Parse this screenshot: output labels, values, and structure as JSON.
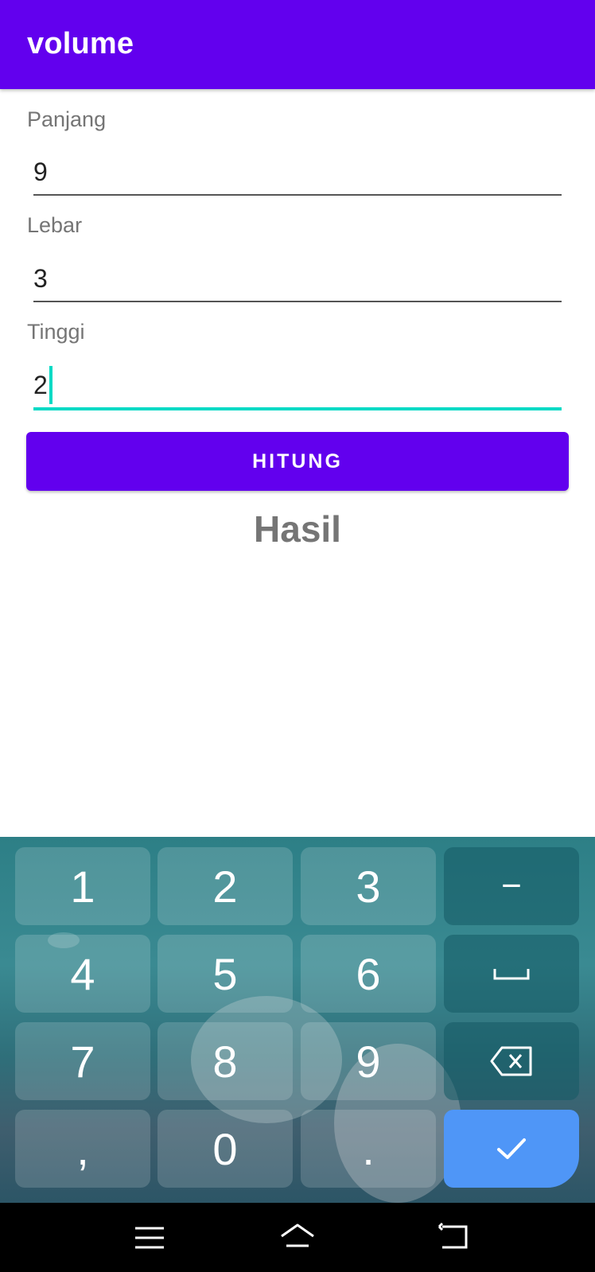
{
  "appbar": {
    "title": "volume"
  },
  "form": {
    "panjang": {
      "label": "Panjang",
      "value": "9"
    },
    "lebar": {
      "label": "Lebar",
      "value": "3"
    },
    "tinggi": {
      "label": "Tinggi",
      "value": "2"
    }
  },
  "actions": {
    "hitung_label": "HITUNG"
  },
  "result": {
    "label": "Hasil"
  },
  "keyboard": {
    "rows": [
      [
        "1",
        "2",
        "3",
        "−"
      ],
      [
        "4",
        "5",
        "6",
        "␣"
      ],
      [
        "7",
        "8",
        "9",
        "⌫"
      ],
      [
        ",",
        "0",
        ".",
        "✓"
      ]
    ]
  },
  "colors": {
    "primary": "#6200ee",
    "accent": "#03dac5",
    "enter_key": "#4f96f7"
  },
  "navbar": {
    "icons": [
      "menu-icon",
      "home-icon",
      "back-icon"
    ]
  }
}
